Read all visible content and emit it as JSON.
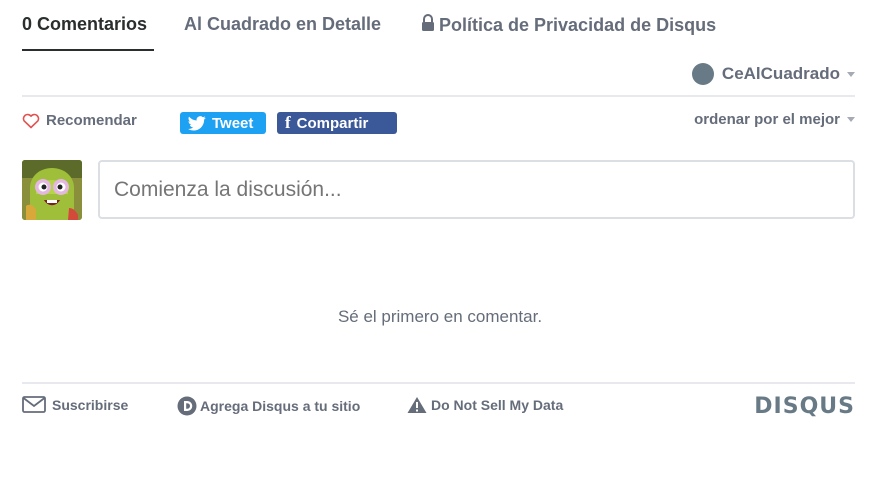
{
  "nav": {
    "tabs": [
      {
        "label": "0 Comentarios",
        "active": true
      },
      {
        "label": "Al Cuadrado en Detalle",
        "active": false
      },
      {
        "label": "Política de Privacidad de Disqus",
        "active": false,
        "icon": "lock-icon"
      }
    ]
  },
  "user": {
    "name": "CeAlCuadrado",
    "icon": "user-avatar-icon"
  },
  "actions": {
    "recommend_label": "Recomendar",
    "tweet_label": "Tweet",
    "share_label": "Compartir",
    "sort_label": "ordenar por el mejor"
  },
  "composer": {
    "placeholder": "Comienza la discusión..."
  },
  "empty_message": "Sé el primero en comentar.",
  "footer": {
    "subscribe_label": "Suscribirse",
    "add_disqus_label": "Agrega Disqus a tu sitio",
    "do_not_sell_label": "Do Not Sell My Data",
    "logo_text": "DISQUS"
  },
  "colors": {
    "text_primary": "#2a2e2e",
    "text_muted": "#656c7a",
    "twitter_blue": "#1da1f2",
    "facebook_blue": "#3b5998",
    "heart_red": "#e2514f",
    "divider": "#e7e9ee"
  }
}
